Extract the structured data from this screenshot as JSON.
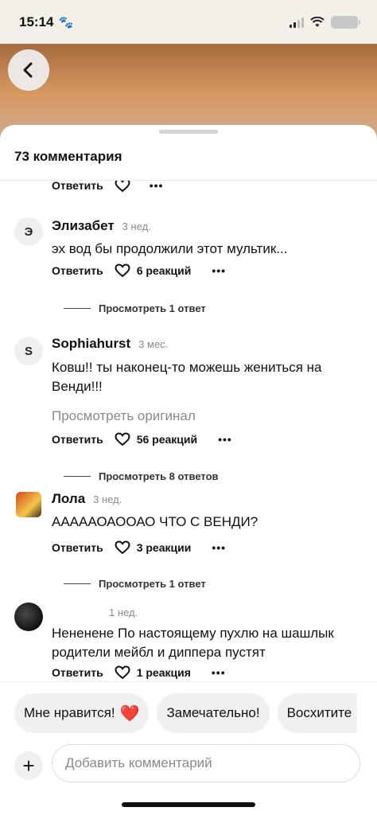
{
  "status": {
    "time": "15:14",
    "paw": "🐾"
  },
  "sheet": {
    "title": "73 комментария"
  },
  "top_actions": {
    "reply": "Ответить",
    "more": "•••"
  },
  "comments": [
    {
      "avatar_letter": "Э",
      "author": "Элизабет",
      "time": "3 нед.",
      "text": "эх вод бы продолжили этот мультик...",
      "reply": "Ответить",
      "reactions": "6 реакций",
      "more": "•••",
      "thread": "Просмотреть 1 ответ"
    },
    {
      "avatar_letter": "S",
      "author": "Sophiahurst",
      "time": "3 мес.",
      "text": "Ковш!! ты наконец-то можешь жениться на Венди!!!",
      "view_original": "Просмотреть оригинал",
      "reply": "Ответить",
      "reactions": "56 реакций",
      "more": "•••",
      "thread": "Просмотреть 8 ответов"
    },
    {
      "author": "Лола",
      "time": "3 нед.",
      "text": "АААААОАООАО ЧТО С ВЕНДИ?",
      "reply": "Ответить",
      "reactions": "3 реакции",
      "more": "•••",
      "thread": "Просмотреть 1 ответ"
    },
    {
      "author": "",
      "time": "1 нед.",
      "text": "Нененене По настоящему пухлю на шашлык родители мейбл и диппера пустят",
      "reply": "Ответить",
      "reactions": "1 реакция",
      "more": "•••"
    }
  ],
  "chips": [
    "Мне нравится!",
    "Замечательно!",
    "Восхитите"
  ],
  "chip_heart": "❤️",
  "composer": {
    "plus": "+",
    "placeholder": "Добавить комментарий"
  },
  "colors": {
    "heart": "#e0243a",
    "muted": "#8a8a8a"
  }
}
